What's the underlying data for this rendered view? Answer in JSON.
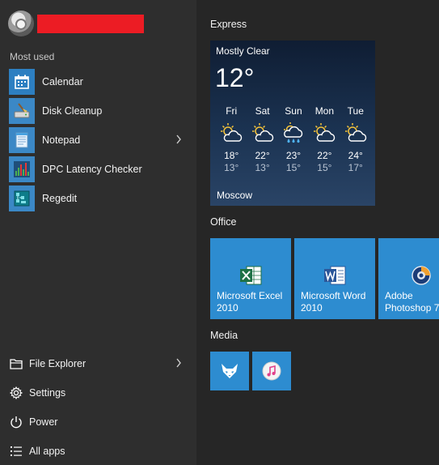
{
  "left": {
    "most_used_label": "Most used",
    "apps": [
      {
        "label": "Calendar",
        "icon": "calendar-icon",
        "has_submenu": false
      },
      {
        "label": "Disk Cleanup",
        "icon": "disk-cleanup-icon",
        "has_submenu": false
      },
      {
        "label": "Notepad",
        "icon": "notepad-icon",
        "has_submenu": true
      },
      {
        "label": "DPC Latency Checker",
        "icon": "dpc-latency-icon",
        "has_submenu": false
      },
      {
        "label": "Regedit",
        "icon": "regedit-icon",
        "has_submenu": false
      }
    ],
    "system": [
      {
        "label": "File Explorer",
        "icon": "folder-icon",
        "has_submenu": true
      },
      {
        "label": "Settings",
        "icon": "gear-icon",
        "has_submenu": false
      },
      {
        "label": "Power",
        "icon": "power-icon",
        "has_submenu": false
      },
      {
        "label": "All apps",
        "icon": "list-icon",
        "has_submenu": false
      }
    ],
    "redaction_color": "#ec1c24"
  },
  "groups": {
    "express": "Express",
    "office": "Office",
    "media": "Media"
  },
  "weather": {
    "condition": "Mostly Clear",
    "current_temp": "12°",
    "city": "Moscow",
    "forecast": [
      {
        "day": "Fri",
        "high": "18°",
        "low": "13°",
        "icon": "partly-sunny-icon"
      },
      {
        "day": "Sat",
        "high": "22°",
        "low": "13°",
        "icon": "partly-sunny-icon"
      },
      {
        "day": "Sun",
        "high": "23°",
        "low": "15°",
        "icon": "rain-icon"
      },
      {
        "day": "Mon",
        "high": "22°",
        "low": "15°",
        "icon": "partly-sunny-icon"
      },
      {
        "day": "Tue",
        "high": "24°",
        "low": "17°",
        "icon": "partly-sunny-icon"
      }
    ]
  },
  "tiles": {
    "excel": {
      "line1": "Microsoft Excel",
      "line2": "2010"
    },
    "word": {
      "line1": "Microsoft Word",
      "line2": "2010"
    },
    "photoshop": {
      "line1": "Adobe",
      "line2": "Photoshop 7"
    },
    "foobar": {
      "icon": "fox-mask-icon"
    },
    "itunes": {
      "icon": "music-note-icon"
    }
  },
  "colors": {
    "tile_blue": "#2d8cd0",
    "left_bg": "#2e2e2e",
    "right_bg": "#262626"
  }
}
